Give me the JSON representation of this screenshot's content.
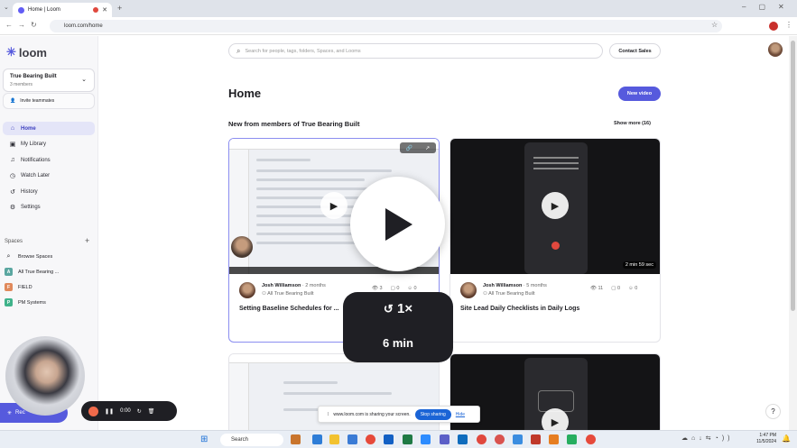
{
  "browser": {
    "tab_title": "Home | Loom",
    "url": "loom.com/home"
  },
  "sidebar": {
    "brand": "loom",
    "workspace_name": "True Bearing Built",
    "workspace_members": "3 members",
    "invite": "Invite teammates",
    "nav": [
      "Home",
      "My Library",
      "Notifications",
      "Watch Later",
      "History",
      "Settings"
    ],
    "spaces_header": "Spaces",
    "spaces": [
      {
        "letter": "",
        "label": "Browse Spaces",
        "color": ""
      },
      {
        "letter": "A",
        "label": "All True Bearing ...",
        "color": "#5aa6a0"
      },
      {
        "letter": "F",
        "label": "FIELD",
        "color": "#e0895b"
      },
      {
        "letter": "P",
        "label": "PM Systems",
        "color": "#3fb28a"
      }
    ]
  },
  "header": {
    "search_placeholder": "Search for people, tags, folders, Spaces, and Looms",
    "contact_sales": "Contact Sales"
  },
  "main": {
    "title": "Home",
    "new_video": "New video",
    "section_title": "New from members of True Bearing Built",
    "show_more": "Show more (16)",
    "videos": [
      {
        "author": "Josh Williamson",
        "time": "· 2 months",
        "space": "All True Bearing Built",
        "views": "3",
        "comments": "0",
        "reactions": "0",
        "title": "Setting Baseline Schedules for ...",
        "duration": ""
      },
      {
        "author": "Josh Williamson",
        "time": "· 5 months",
        "space": "All True Bearing Built",
        "views": "11",
        "comments": "0",
        "reactions": "0",
        "title": "Site Lead Daily Checklists in Daily Logs",
        "duration": "2 min 59 sec"
      }
    ]
  },
  "overlay": {
    "speed": "1×",
    "duration": "6 min"
  },
  "recorder": {
    "timer": "0:00",
    "loom_label": "Rec"
  },
  "share_banner": {
    "text": "www.loom.com is sharing your screen.",
    "stop": "Stop sharing",
    "hide": "Hide"
  },
  "taskbar": {
    "search": "Search",
    "time": "1:47 PM",
    "date": "11/5/2024"
  },
  "colors": {
    "accent": "#565add",
    "active_nav_bg": "#e4e5f8"
  }
}
